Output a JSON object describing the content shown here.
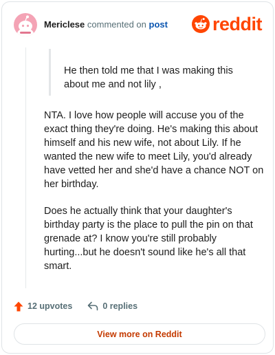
{
  "header": {
    "username": "Mericlese",
    "action_text": "commented on",
    "post_link": "post",
    "logo_text": "reddit"
  },
  "quote": {
    "text": "He then told me that I was making this about me and not lily ,"
  },
  "comment": {
    "paragraphs": [
      "NTA. I love how people will accuse you of the exact thing they're doing. He's making this about himself and his new wife, not about Lily. If he wanted the new wife to meet Lily, you'd already have vetted her and she'd have a chance NOT on her birthday.",
      "Does he actually think that your daughter's birthday party is the place to pull the pin on that grenade at? I know you're still probably hurting...but he doesn't sound like he's all that smart."
    ]
  },
  "actions": {
    "upvotes": "12 upvotes",
    "replies": "0 replies"
  },
  "footer": {
    "view_more": "View more on Reddit"
  },
  "colors": {
    "brand": "#ff4500",
    "upvote": "#ff4500",
    "link": "#0a55b0",
    "avatar_bg": "#f4a3b5",
    "muted": "#576f76"
  },
  "icons": [
    "avatar-snoo-icon",
    "reddit-logo-icon",
    "upvote-arrow-icon",
    "reply-icon"
  ]
}
